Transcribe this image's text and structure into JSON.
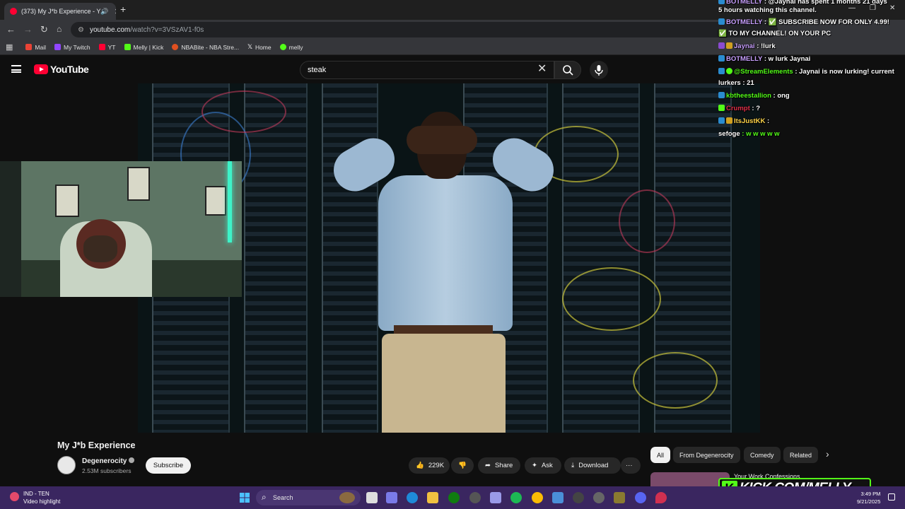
{
  "browser": {
    "tab_title": "(373) My J*b Experience - Y",
    "url_host": "youtube.com",
    "url_path": "/watch?v=3VSzAV1-f0s",
    "bookmarks": [
      {
        "label": "Mail",
        "color": "#ea4335"
      },
      {
        "label": "My Twitch",
        "color": "#9146ff"
      },
      {
        "label": "YT",
        "color": "#ff0033"
      },
      {
        "label": "Melly | Kick",
        "color": "#53fc18"
      },
      {
        "label": "NBABite - NBA Stre...",
        "color": "#e05020"
      },
      {
        "label": "Home",
        "color": "#ffffff"
      },
      {
        "label": "melly",
        "color": "#53fc18"
      }
    ]
  },
  "youtube": {
    "logo_text": "YouTube",
    "search_value": "steak",
    "video_title": "My J*b Experience",
    "channel_name": "Degenerocity",
    "subscribers": "2.53M subscribers",
    "subscribe_label": "Subscribe",
    "likes": "229K",
    "share_label": "Share",
    "ask_label": "Ask",
    "download_label": "Download",
    "more_label": "···",
    "chips": [
      "All",
      "From Degenerocity",
      "Comedy",
      "Related"
    ],
    "chip_next": "›",
    "reco_title": "Your Work Confessions"
  },
  "chat": {
    "lines": [
      {
        "user": "BOTMELLY",
        "color": "#c9a0ff",
        "text": ": @Jaynai has spent 1 months 21 days"
      },
      {
        "user": "",
        "color": "#ffffff",
        "text": "5 hours watching this channel."
      },
      {
        "user": "BOTMELLY",
        "color": "#c9a0ff",
        "text": ": ✅ SUBSCRIBE NOW FOR ONLY 4.99!"
      },
      {
        "user": "",
        "color": "#ffffff",
        "text": "✅ TO MY CHANNEL! ON YOUR PC"
      },
      {
        "user": "Jaynai",
        "color": "#c9a0ff",
        "text": ": !lurk"
      },
      {
        "user": "BOTMELLY",
        "color": "#c9a0ff",
        "text": ": w lurk Jaynai"
      },
      {
        "user": "@StreamElements",
        "color": "#53fc18",
        "text": ": Jaynai is now lurking! current"
      },
      {
        "user": "",
        "color": "#ffffff",
        "text": "lurkers : 21"
      },
      {
        "user": "kbtheestallion",
        "color": "#53fc18",
        "text": ": ong"
      },
      {
        "user": "Crumpt",
        "color": "#e0304a",
        "text": ": ?"
      },
      {
        "user": "ItsJustKK",
        "color": "#ffd54a",
        "text": ":"
      },
      {
        "user": "sefoge",
        "color": "#ffffff",
        "text": ": w w w w w"
      }
    ],
    "banner": "KICK.COM/MELLY",
    "banner_k": "K"
  },
  "taskbar": {
    "weather_title": "IND - TEN",
    "weather_sub": "Video highlight",
    "search_placeholder": "Search",
    "time": "3:49 PM",
    "date": "9/21/2025"
  },
  "colors": {
    "yt_red": "#ff0033",
    "kick_green": "#53fc18",
    "taskbar": "#3a2660"
  }
}
